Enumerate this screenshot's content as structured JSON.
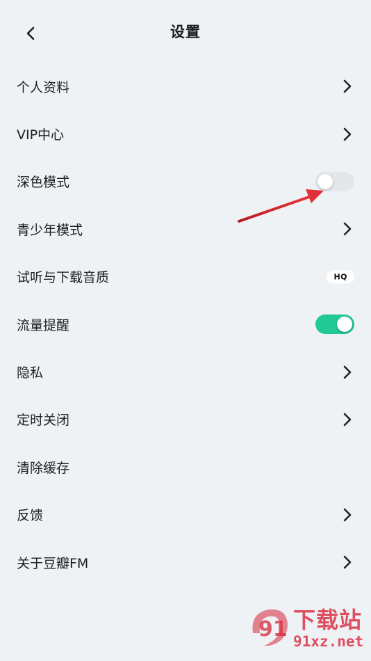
{
  "header": {
    "title": "设置"
  },
  "items": [
    {
      "label": "个人资料",
      "control": "chevron"
    },
    {
      "label": "VIP中心",
      "control": "chevron"
    },
    {
      "label": "深色模式",
      "control": "toggle",
      "on": false
    },
    {
      "label": "青少年模式",
      "control": "chevron"
    },
    {
      "label": "试听与下载音质",
      "control": "badge",
      "badge": "HQ"
    },
    {
      "label": "流量提醒",
      "control": "toggle",
      "on": true
    },
    {
      "label": "隐私",
      "control": "chevron"
    },
    {
      "label": "定时关闭",
      "control": "chevron"
    },
    {
      "label": "清除缓存",
      "control": "none"
    },
    {
      "label": "反馈",
      "control": "chevron"
    },
    {
      "label": "关于豆瓣FM",
      "control": "chevron"
    }
  ],
  "colors": {
    "toggle_on": "#22c993",
    "toggle_off": "#e3e7ea",
    "arrow": "#d8262f",
    "background": "#eff2f5"
  },
  "watermark": {
    "cn": "下载站",
    "url": "91xz.net",
    "logo": "91"
  }
}
